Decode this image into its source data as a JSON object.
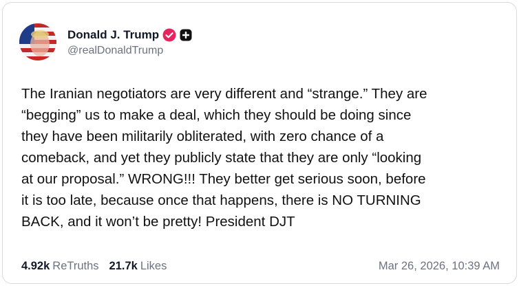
{
  "post": {
    "author": {
      "display_name": "Donald J. Trump",
      "handle": "@realDonaldTrump",
      "verified_badge_icon": "verified-badge-icon",
      "plus_badge_icon": "plus-badge-icon",
      "verified_color": "#e6245e"
    },
    "text": "The Iranian negotiators are very different and “strange.” They are\n“begging” us to make a deal, which they should be doing since\nthey have been militarily obliterated, with zero chance of a\ncomeback, and yet they publicly state that they are only “looking\nat our proposal.” WRONG!!! They better get serious soon, before\nit is too late, because once that happens, there is NO TURNING\nBACK, and it won’t be pretty! President DJT",
    "stats": {
      "retruths_value": "4.92k",
      "retruths_label": "ReTruths",
      "likes_value": "21.7k",
      "likes_label": "Likes"
    },
    "timestamp": "Mar 26, 2026, 10:39 AM"
  }
}
